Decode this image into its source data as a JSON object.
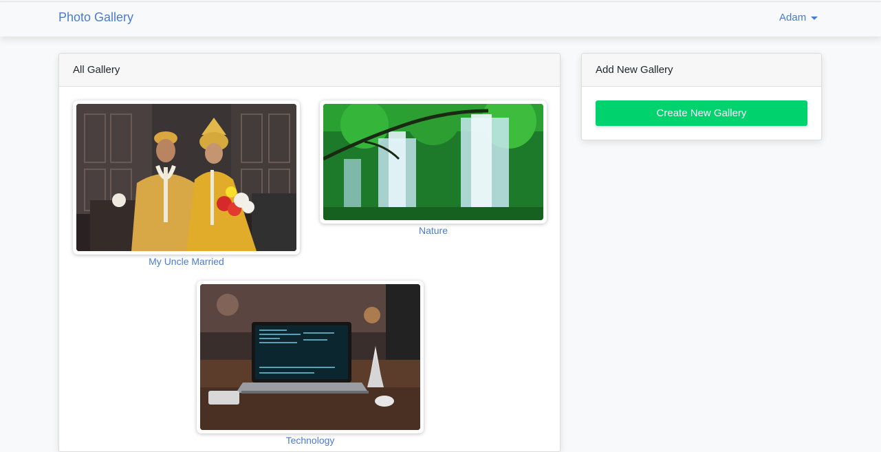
{
  "navbar": {
    "brand": "Photo Gallery",
    "user": "Adam"
  },
  "gallery_panel": {
    "title": "All Gallery",
    "items": [
      {
        "caption": "My Uncle Married",
        "image": "wedding-photo"
      },
      {
        "caption": "Nature",
        "image": "waterfall-photo"
      },
      {
        "caption": "Technology",
        "image": "laptop-photo"
      }
    ]
  },
  "add_panel": {
    "title": "Add New Gallery",
    "button": "Create New Gallery"
  },
  "colors": {
    "link": "#4a7bd0",
    "button": "#00d26e",
    "background": "#f8f9fa"
  }
}
